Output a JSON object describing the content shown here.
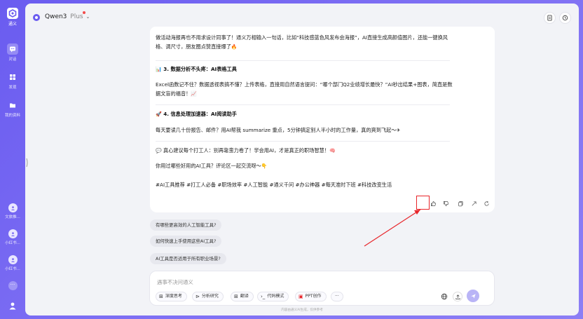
{
  "sidebar": {
    "logo_label": "通义",
    "items": [
      {
        "label": "对话",
        "icon": "chat-icon",
        "active": true
      },
      {
        "label": "发现",
        "icon": "discover-icon",
        "active": false
      },
      {
        "label": "我的资料",
        "icon": "folder-icon",
        "active": false
      }
    ],
    "recent": [
      {
        "label": "文旅推..."
      },
      {
        "label": "小红书..."
      },
      {
        "label": "小红书..."
      }
    ],
    "more": "···"
  },
  "topbar": {
    "model": "Qwen3",
    "tier": "Plus"
  },
  "answer": {
    "intro": "做活动海报再也不用求设计同事了！通义万相输入一句话，比如“科技感蓝色风发布会海报”，AI直接生成高颜值图片，还能一键换风格、调尺寸，朋友圈点赞直接爆了",
    "sec3_title": "3. 数据分析不头疼：AI表格工具",
    "sec3_body": "Excel函数记不住？数据透视表搞不懂？上传表格，直接用自然语言提问：“哪个部门Q2业绩增长最快？”AI秒出结果+图表，简直是数据文盲的福音！",
    "sec4_title": "4. 信息处理加速器：AI阅读助手",
    "sec4_body": "每天要读几十份报告、邮件？用AI帮我 summarize 重点，5分钟搞定别人半小时的工作量，真的爽到飞起～",
    "advice": "真心建议每个打工人：别再靠蛮力卷了！学会用AI，才是真正的职场智慧！",
    "question": "你用过哪些好用的AI工具？评论区一起交流呀～",
    "tags": "#AI工具推荐 #打工人必备 #职场效率 #人工智能 #通义千问 #办公神器 #每天准时下班 #科技改变生活"
  },
  "suggestions": [
    "有哪些更高效的人工智能工具?",
    "如何快速上手使用这些AI工具?",
    "AI工具是否适用于所有职业场景?"
  ],
  "input": {
    "placeholder": "遇事不决问通义",
    "tools": [
      "深度思考",
      "分析研究",
      "翻译",
      "代码模式",
      "PPT创作"
    ],
    "more": "···"
  },
  "footer": "内容由通义AI生成，仅供参考",
  "colors": {
    "brand": "#6b5cf0",
    "highlight_box": "#e8262b"
  }
}
